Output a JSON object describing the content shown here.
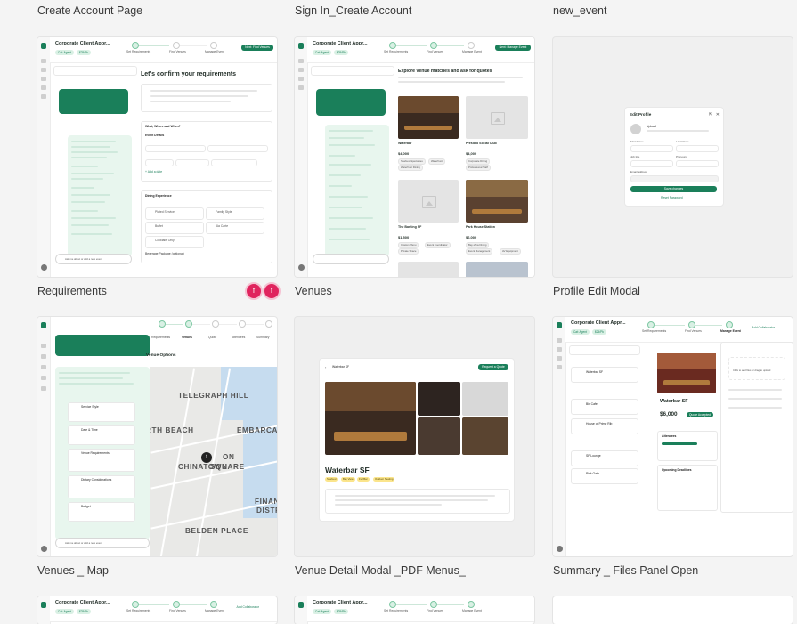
{
  "frames": {
    "create_account_page": {
      "label": "Create Account Page"
    },
    "sign_in_create_account": {
      "label": "Sign In_Create Account"
    },
    "new_event": {
      "label": "new_event"
    },
    "requirements": {
      "label": "Requirements",
      "title": "Corporate Client Appr...",
      "chips": [
        "Cat: Agent",
        "$25/Pk"
      ],
      "steps": [
        "Set Requirements",
        "Find Venues",
        "Manage Event"
      ],
      "action": "Next: Find Venues",
      "heading": "Let's confirm your requirements",
      "sub_sections": [
        "What, Where and When?",
        "Event Details",
        "Dining Experience",
        "Beverage Package (optional)"
      ],
      "meal_options": [
        "Plated Service",
        "Family Style",
        "Buffet",
        "Ala Carte",
        "Cocktails Only"
      ],
      "chat_input": "Ask me about or add a new event"
    },
    "venues": {
      "label": "Venues",
      "title": "Corporate Client Appr...",
      "heading": "Explore venue matches and ask for quotes",
      "action": "Next: Manage Event",
      "cards": [
        {
          "name": "Waterbar",
          "price": "$4,000"
        },
        {
          "name": "Presidio Social Club",
          "price": "$4,000"
        },
        {
          "name": "The Barking SF",
          "price": "$1,500"
        },
        {
          "name": "Park House Station",
          "price": "$6,000"
        }
      ]
    },
    "profile_edit_modal": {
      "label": "Profile Edit Modal",
      "modal_title": "Edit Profile",
      "upload": "Upload",
      "fields": [
        "First Name",
        "Last Name",
        "Job title",
        "Pronouns",
        "Email address"
      ],
      "save": "Save changes",
      "reset": "Reset Password"
    },
    "venues_map": {
      "label": "Venues _ Map",
      "panel_title": "Venue Options",
      "steps": [
        "Requirements",
        "Venues",
        "Quote",
        "Attendees",
        "Summary"
      ],
      "map_labels": [
        "TELEGRAPH HILL",
        "RTH BEACH",
        "EMBARCADE",
        "CHINATOWN",
        "ON",
        "SQUARE",
        "FINAN",
        "DISTRI",
        "BELDEN PLACE"
      ],
      "list_items": [
        "Service Style",
        "Date & Time",
        "Venue Requirements",
        "Dietary Considerations",
        "Budget"
      ],
      "chat_input": "Ask me about or add a new event"
    },
    "venue_detail_modal": {
      "label": "Venue Detail Modal _PDF Menus_",
      "header": "Waterbar SF",
      "action": "Request a Quote",
      "venue_name": "Waterbar SF",
      "tags": [
        "Seafood",
        "Bay View",
        "Full Bar",
        "Outdoor Seating"
      ]
    },
    "summary_files_panel": {
      "label": "Summary _ Files Panel Open",
      "title": "Corporate Client Appr...",
      "steps": [
        "Set Requirements",
        "Find Venues",
        "Manage Event"
      ],
      "action": "Add Collaborator",
      "venue_name": "Waterbar SF",
      "price": "$6,000",
      "sections": [
        "Attendees",
        "Upcoming Deadlines"
      ],
      "upload_hint": "Click to add files or drag to upload",
      "venues_list": [
        "Waterbar SF",
        "Bix Cafe",
        "House of Prime Rib",
        "SF Lounge",
        "Pink Gate"
      ]
    },
    "bottom_left": {
      "title": "Corporate Client Appr...",
      "steps": [
        "Set Requirements",
        "Find Venues",
        "Manage Event"
      ],
      "action": "Add Collaborator"
    },
    "bottom_middle": {
      "title": "Corporate Client Appr...",
      "steps": [
        "Set Requirements",
        "Find Venues",
        "Manage Event"
      ]
    }
  },
  "badges": [
    "f",
    "f"
  ],
  "colors": {
    "accent": "#1a7f5a",
    "badge": "#e0245e",
    "canvas": "#f4f4f4"
  }
}
